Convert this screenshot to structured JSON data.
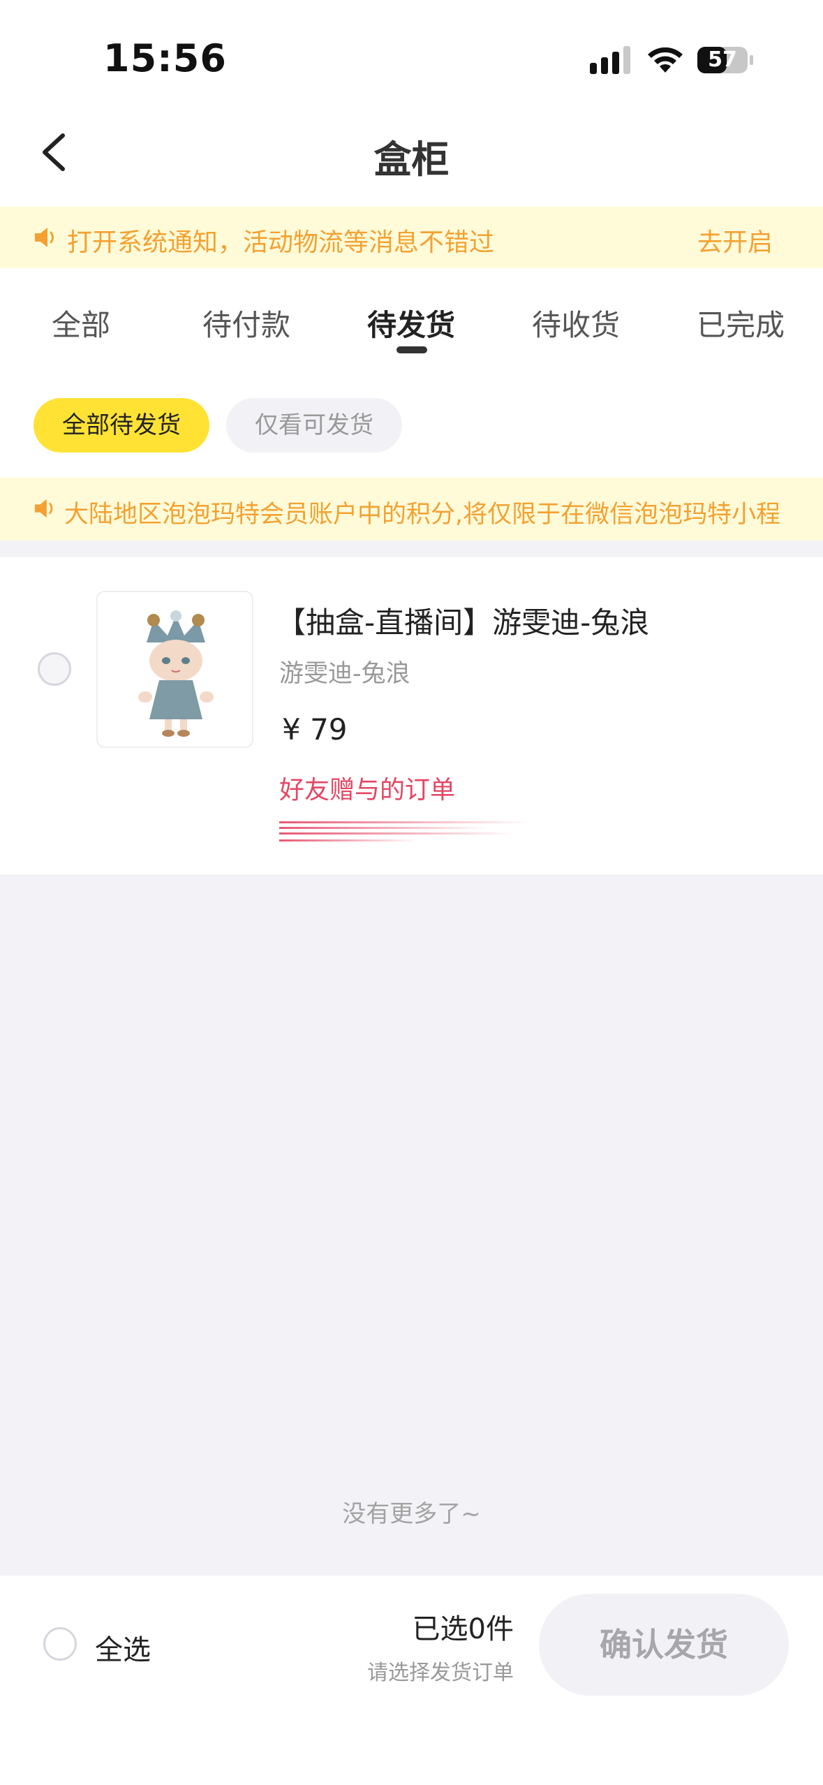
{
  "status_bar": {
    "time": "15:56",
    "battery": "57"
  },
  "nav": {
    "title": "盒柜"
  },
  "notice": {
    "text": "打开系统通知，活动物流等消息不错过",
    "action": "去开启"
  },
  "tabs": [
    {
      "label": "全部",
      "active": false
    },
    {
      "label": "待付款",
      "active": false
    },
    {
      "label": "待发货",
      "active": true
    },
    {
      "label": "待收货",
      "active": false
    },
    {
      "label": "已完成",
      "active": false
    }
  ],
  "filters": {
    "all_pending": "全部待发货",
    "shippable_only": "仅看可发货"
  },
  "member_notice": {
    "text": "大陆地区泡泡玛特会员账户中的积分,将仅限于在微信泡泡玛特小程"
  },
  "order": {
    "title": "【抽盒-直播间】游雯迪-兔浪",
    "subtitle": "游雯迪-兔浪",
    "price": "¥ 79",
    "gift_label": "好友赠与的订单"
  },
  "list_end": "没有更多了~",
  "bottom": {
    "select_all": "全选",
    "selected_count": "已选0件",
    "hint": "请选择发货订单",
    "confirm": "确认发货"
  },
  "colors": {
    "accent_yellow": "#ffe234",
    "notice_bg": "#fffbd9",
    "notice_text": "#f4a131",
    "gift_red": "#e44663",
    "page_bg": "#f3f3f7"
  }
}
